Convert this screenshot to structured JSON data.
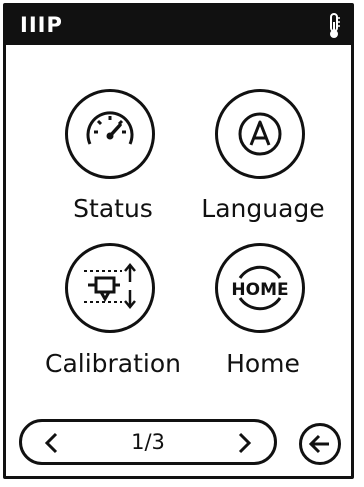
{
  "header": {
    "title": "IIIP",
    "status_icon": "thermometer-icon"
  },
  "menu": {
    "items": [
      {
        "label": "Status",
        "icon": "gauge-icon"
      },
      {
        "label": "Language",
        "icon": "letter-a-icon"
      },
      {
        "label": "Calibration",
        "icon": "calibration-icon"
      },
      {
        "label": "Home",
        "icon_text": "HOME"
      }
    ]
  },
  "pagination": {
    "page_indicator": "1/3",
    "prev_icon": "chevron-left-icon",
    "next_icon": "chevron-right-icon"
  },
  "footer": {
    "back_icon": "back-arrow-icon"
  }
}
